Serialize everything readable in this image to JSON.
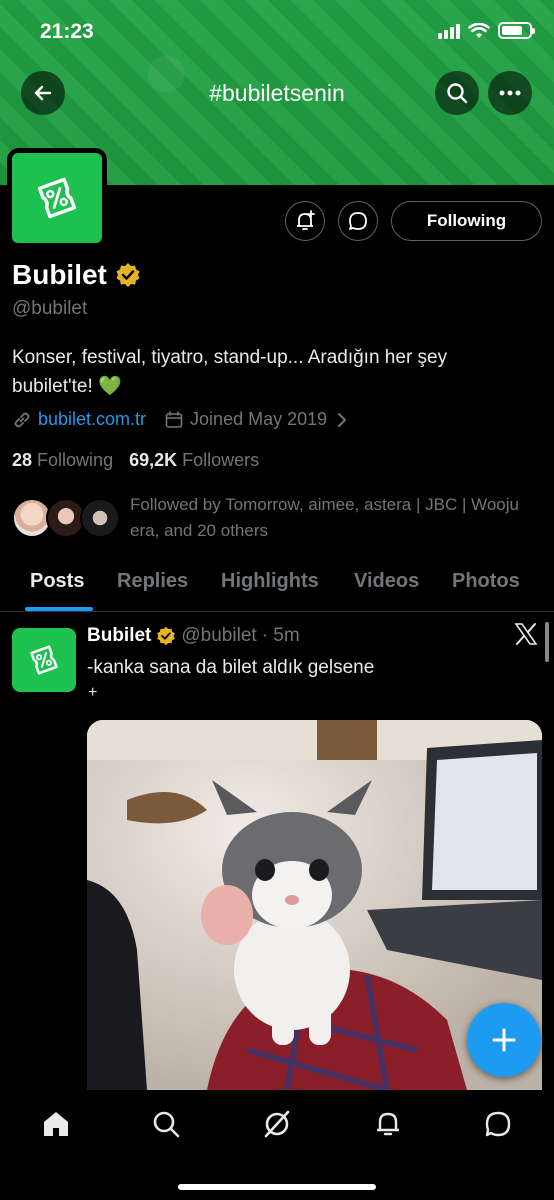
{
  "status_bar": {
    "time": "21:23",
    "battery_level": 0.75
  },
  "header": {
    "hashtag": "#bubiletsenin",
    "back_icon": "arrow-left-icon",
    "search_icon": "search-icon",
    "more_icon": "more-horizontal-icon"
  },
  "profile": {
    "name": "Bubilet",
    "handle": "@bubilet",
    "bio": "Konser, festival, tiyatro, stand-up... Aradığın her şey bubilet'te! 💚",
    "website": "bubilet.com.tr",
    "joined": "Joined May 2019",
    "following_count": "28",
    "following_label": "Following",
    "followers_count": "69,2K",
    "followers_label": "Followers",
    "followed_by": "Followed by Tomorrow, aimee, astera | JBC | Wooju era, and 20 others",
    "following_button": "Following",
    "brand_color": "#1cc150"
  },
  "tabs": [
    {
      "label": "Posts",
      "active": true
    },
    {
      "label": "Replies",
      "active": false
    },
    {
      "label": "Highlights",
      "active": false
    },
    {
      "label": "Videos",
      "active": false
    },
    {
      "label": "Photos",
      "active": false
    }
  ],
  "post": {
    "name": "Bubilet",
    "handle": "@bubilet",
    "time": "· 5m",
    "text": "-kanka sana da bilet aldık gelsene",
    "plus": "+"
  },
  "colors": {
    "accent": "#1d9bf0",
    "banner": "#22a345",
    "verified": "#e5b422"
  }
}
